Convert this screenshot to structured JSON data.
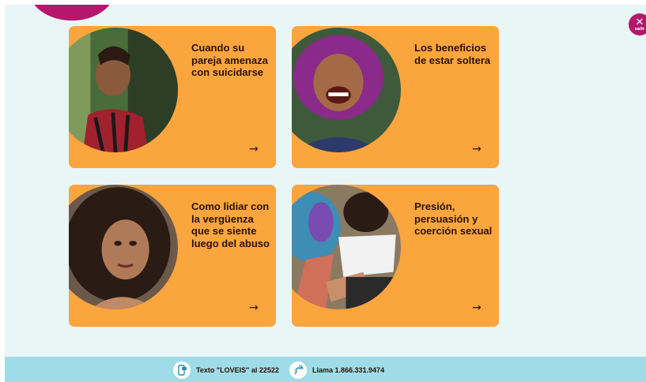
{
  "exit": {
    "icon": "close-icon",
    "label": "salir"
  },
  "cards": [
    {
      "title": "Cuando su pareja amenaza con suicidarse",
      "arrow": "→",
      "arrow_icon": "arrow-right-icon"
    },
    {
      "title": "Los beneficios de estar soltera",
      "arrow": "→",
      "arrow_icon": "arrow-right-icon"
    },
    {
      "title": "Como lidiar con la vergüenza que se siente luego del abuso",
      "arrow": "→",
      "arrow_icon": "arrow-right-icon"
    },
    {
      "title": "Presión, persuasión y coerción sexual",
      "arrow": "→",
      "arrow_icon": "arrow-right-icon"
    }
  ],
  "footer": {
    "text_cta": "Texto \"LOVEIS\" al 22522",
    "call_cta": "Llama 1.866.331.9474",
    "text_icon": "phone-message-icon",
    "call_icon": "phone-call-icon"
  },
  "colors": {
    "background": "#e9f6f6",
    "card": "#fba53f",
    "accent": "#b5176d",
    "footer": "#9fdce8",
    "text": "#2a1206"
  }
}
